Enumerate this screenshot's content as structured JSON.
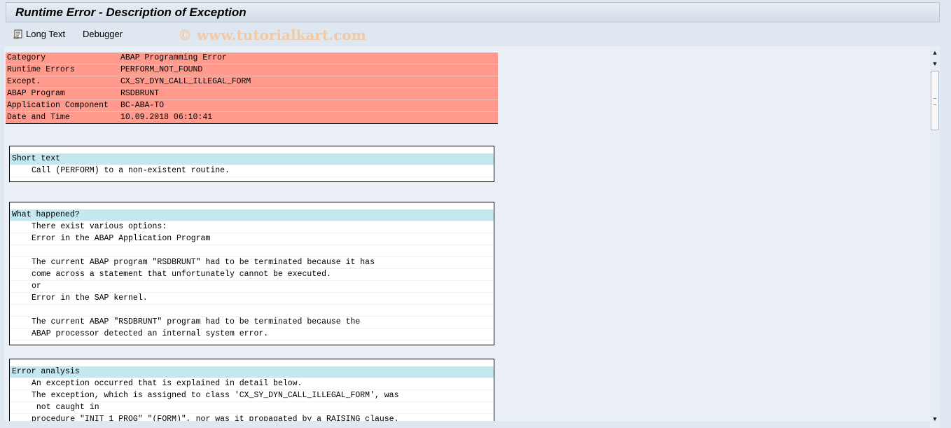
{
  "title": "Runtime Error - Description of Exception",
  "toolbar": {
    "long_text": "Long Text",
    "debugger": "Debugger"
  },
  "watermark": "© www.tutorialkart.com",
  "header_rows": [
    {
      "key": "Category",
      "value": "ABAP Programming Error"
    },
    {
      "key": "Runtime Errors",
      "value": "PERFORM_NOT_FOUND"
    },
    {
      "key": "Except.",
      "value": "CX_SY_DYN_CALL_ILLEGAL_FORM"
    },
    {
      "key": "ABAP Program",
      "value": "RSDBRUNT"
    },
    {
      "key": "Application Component",
      "value": "BC-ABA-TO"
    },
    {
      "key": "Date and Time",
      "value": "10.09.2018 06:10:41"
    }
  ],
  "sections": {
    "short_text": {
      "heading": "Short text",
      "lines": [
        "Call (PERFORM) to a non-existent routine."
      ]
    },
    "what_happened": {
      "heading": "What happened?",
      "lines": [
        "There exist various options:",
        "Error in the ABAP Application Program",
        "",
        "The current ABAP program \"RSDBRUNT\" had to be terminated because it has",
        "come across a statement that unfortunately cannot be executed.",
        "or",
        "Error in the SAP kernel.",
        "",
        "The current ABAP \"RSDBRUNT\" program had to be terminated because the",
        "ABAP processor detected an internal system error."
      ]
    },
    "error_analysis": {
      "heading": "Error analysis",
      "lines": [
        "An exception occurred that is explained in detail below.",
        "The exception, which is assigned to class 'CX_SY_DYN_CALL_ILLEGAL_FORM', was",
        " not caught in",
        "procedure \"INIT_1_PROG\" \"(FORM)\", nor was it propagated by a RAISING clause."
      ]
    }
  },
  "icons": {
    "long_text": "document-scroll-icon",
    "scroll_up": "arrow-up-icon",
    "scroll_down": "arrow-down-icon"
  }
}
